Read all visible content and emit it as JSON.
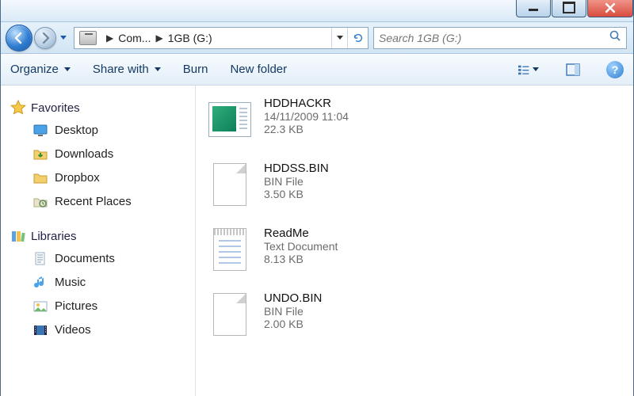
{
  "address": {
    "segments": [
      "Com...",
      "1GB (G:)"
    ]
  },
  "search": {
    "placeholder": "Search 1GB (G:)"
  },
  "toolbar": {
    "organize": "Organize",
    "share": "Share with",
    "burn": "Burn",
    "newfolder": "New folder"
  },
  "sidebar": {
    "favorites": {
      "label": "Favorites",
      "items": [
        {
          "label": "Desktop",
          "icon": "desktop"
        },
        {
          "label": "Downloads",
          "icon": "downloads"
        },
        {
          "label": "Dropbox",
          "icon": "dropbox"
        },
        {
          "label": "Recent Places",
          "icon": "recent"
        }
      ]
    },
    "libraries": {
      "label": "Libraries",
      "items": [
        {
          "label": "Documents",
          "icon": "documents"
        },
        {
          "label": "Music",
          "icon": "music"
        },
        {
          "label": "Pictures",
          "icon": "pictures"
        },
        {
          "label": "Videos",
          "icon": "videos"
        }
      ]
    }
  },
  "files": [
    {
      "name": "HDDHACKR",
      "line2": "14/11/2009 11:04",
      "line3": "22.3 KB",
      "thumb": "app"
    },
    {
      "name": "HDDSS.BIN",
      "line2": "BIN File",
      "line3": "3.50 KB",
      "thumb": "blank"
    },
    {
      "name": "ReadMe",
      "line2": "Text Document",
      "line3": "8.13 KB",
      "thumb": "txt"
    },
    {
      "name": "UNDO.BIN",
      "line2": "BIN File",
      "line3": "2.00 KB",
      "thumb": "blank"
    }
  ]
}
